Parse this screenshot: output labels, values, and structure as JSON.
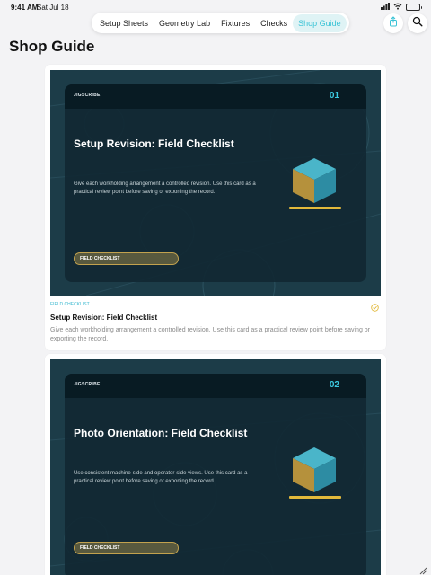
{
  "status_bar": {
    "time": "9:41 AM",
    "date": "Sat Jul 18",
    "battery_color": "#34c759",
    "battery_level": 0.6
  },
  "nav": {
    "tabs": [
      {
        "label": "Setup Sheets",
        "active": false
      },
      {
        "label": "Geometry Lab",
        "active": false
      },
      {
        "label": "Fixtures",
        "active": false
      },
      {
        "label": "Checks",
        "active": false
      },
      {
        "label": "Shop Guide",
        "active": true
      }
    ],
    "accent_color": "#39c3d6"
  },
  "toolbar": {
    "share_icon": "share-icon",
    "search_icon": "search-icon"
  },
  "page": {
    "title": "Shop Guide"
  },
  "cards": [
    {
      "brand": "JIGSCRIBE",
      "number": "01",
      "hero_title": "Setup Revision: Field Checklist",
      "hero_desc": "Give each workholding arrangement a controlled revision. Use this card as a practical review point before saving or exporting the record.",
      "hero_button": "FIELD CHECKLIST",
      "tag": "FIELD CHECKLIST",
      "title": "Setup Revision: Field Checklist",
      "description": "Give each workholding arrangement a controlled revision. Use this card as a practical review point before saving or exporting the record.",
      "status_icon": "check-circle-icon"
    },
    {
      "brand": "JIGSCRIBE",
      "number": "02",
      "hero_title": "Photo Orientation: Field Checklist",
      "hero_desc": "Use consistent machine-side and operator-side views. Use this card as a practical review point before saving or exporting the record.",
      "hero_button": "FIELD CHECKLIST"
    }
  ],
  "colors": {
    "hero_bg": "#1c3c48",
    "hero_accent": "#3ccbe2",
    "gold": "#e2b93b"
  }
}
